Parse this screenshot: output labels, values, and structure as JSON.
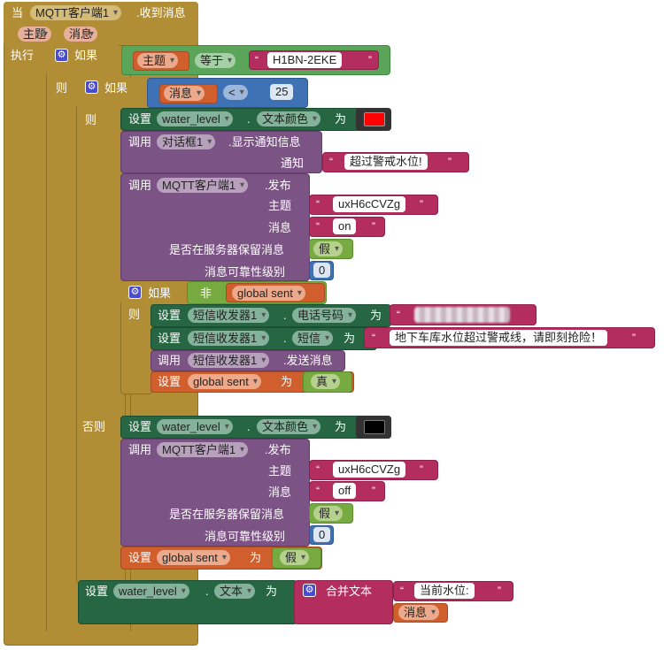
{
  "event": {
    "when": "当",
    "component": "MQTT客户端1",
    "event_name": ".收到消息",
    "params": [
      "主题",
      "消息"
    ],
    "do": "执行"
  },
  "outer_if": {
    "if_label": "如果",
    "then_label": "则",
    "compare_left": "主题",
    "compare_op": "等于",
    "compare_right": "H1BN-2EKE"
  },
  "inner_if": {
    "if_label": "如果",
    "then_label": "则",
    "else_label": "否则",
    "compare_left": "消息",
    "compare_op": "<",
    "compare_right": "25"
  },
  "then_branch": {
    "set_color": {
      "set": "设置",
      "component": "water_level",
      "dot": ".",
      "property": "文本颜色",
      "to": "为",
      "color": "#ff0000"
    },
    "notify": {
      "call": "调用",
      "component": "对话框1",
      "method": ".显示通知信息",
      "arg_label": "通知",
      "arg_value": "超过警戒水位!"
    },
    "publish": {
      "call": "调用",
      "component": "MQTT客户端1",
      "method": ".发布",
      "topic_label": "主题",
      "topic_value": "uxH6cCVZg",
      "msg_label": "消息",
      "msg_value": "on",
      "retain_label": "是否在服务器保留消息",
      "retain_value": "假",
      "qos_label": "消息可靠性级别",
      "qos_value": "0"
    },
    "if_not": {
      "if_label": "如果",
      "then_label": "则",
      "not_label": "非",
      "var": "global sent",
      "set_phone": {
        "set": "设置",
        "component": "短信收发器1",
        "dot": ".",
        "property": "电话号码",
        "to": "为"
      },
      "set_msg": {
        "set": "设置",
        "component": "短信收发器1",
        "dot": ".",
        "property": "短信",
        "to": "为",
        "value": "地下车库水位超过警戒线，请即刻抢险！"
      },
      "send": {
        "call": "调用",
        "component": "短信收发器1",
        "method": ".发送消息"
      },
      "set_sent": {
        "set": "设置",
        "var": "global sent",
        "to": "为",
        "value": "真"
      }
    }
  },
  "else_branch": {
    "set_color": {
      "set": "设置",
      "component": "water_level",
      "dot": ".",
      "property": "文本颜色",
      "to": "为",
      "color": "#000000"
    },
    "publish": {
      "call": "调用",
      "component": "MQTT客户端1",
      "method": ".发布",
      "topic_label": "主题",
      "topic_value": "uxH6cCVZg",
      "msg_label": "消息",
      "msg_value": "off",
      "retain_label": "是否在服务器保留消息",
      "retain_value": "假",
      "qos_label": "消息可靠性级别",
      "qos_value": "0"
    },
    "set_sent": {
      "set": "设置",
      "var": "global sent",
      "to": "为",
      "value": "假"
    }
  },
  "set_text": {
    "set": "设置",
    "component": "water_level",
    "dot": ".",
    "property": "文本",
    "to": "为",
    "join_label": "合并文本",
    "join_first": "当前水位:",
    "join_second": "消息"
  },
  "colors": {
    "event": "#B18E35",
    "control": "#B18E35",
    "compare": "#5BA55B",
    "math": "#3F71B5",
    "text": "#B32D5E",
    "component_setter": "#266643",
    "call": "#7C5385",
    "variable": "#D05F2D",
    "logic": "#77AB41"
  }
}
